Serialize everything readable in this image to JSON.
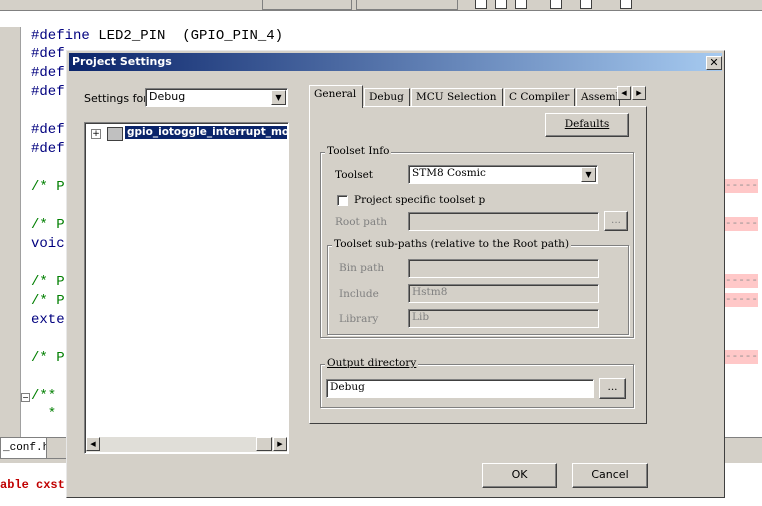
{
  "editor": {
    "lines": [
      {
        "kw": "#define",
        "rest": " LED2_PIN  (GPIO_PIN_4)"
      },
      {
        "kw": "#def",
        "rest": ""
      },
      {
        "kw": "#def",
        "rest": ""
      },
      {
        "kw": "#def",
        "rest": ""
      },
      {
        "kw": "#def",
        "rest": ""
      },
      {
        "kw": "#def",
        "rest": ""
      },
      {
        "cm": "/* P"
      },
      {
        "cm": "/* P"
      },
      {
        "kw": "voic",
        "rest": ""
      },
      {
        "cm": "/* P"
      },
      {
        "cm": "/* P"
      },
      {
        "kw": "exte",
        "rest": ""
      },
      {
        "cm": "/* P"
      },
      {
        "cm": "/**"
      },
      {
        "cm": "  *"
      }
    ],
    "dashes": "-----",
    "file_tab": "_conf.h",
    "output_text": "able cxst"
  },
  "dialog": {
    "title": "Project Settings",
    "close_glyph": "✕",
    "settings_for_label": "Settings for:",
    "settings_for_value": "Debug",
    "tree_item": "gpio_iotoggle_interrupt_mo",
    "tabs": [
      "General",
      "Debug",
      "MCU Selection",
      "C Compiler",
      "Assemb"
    ],
    "defaults_button": "Defaults",
    "toolset_info": {
      "group_title": "Toolset Info",
      "toolset_label": "Toolset",
      "toolset_value": "STM8 Cosmic",
      "project_specific_label": "Project specific toolset p",
      "root_path_label": "Root path",
      "root_path_value": "",
      "browse_label": "...",
      "subpaths_title": "Toolset sub-paths (relative to the Root path)",
      "bin_path_label": "Bin path",
      "bin_path_value": "",
      "include_label": "Include",
      "include_value": "Hstm8",
      "library_label": "Library",
      "library_value": "Lib"
    },
    "output_directory": {
      "group_title": "Output directory",
      "value": "Debug",
      "browse_label": "..."
    },
    "ok_button": "OK",
    "cancel_button": "Cancel"
  },
  "icons": {
    "close": "close-icon",
    "dropdown": "chevron-down-icon",
    "tab_scroll_left": "triangle-left-icon",
    "tab_scroll_right": "triangle-right-icon",
    "tree_expand": "plus-icon",
    "project": "project-icon"
  },
  "colors": {
    "titlebar_start": "#0a246a",
    "titlebar_end": "#a6caf0",
    "dialog_face": "#d4d0c8",
    "selection": "#0a246a",
    "keyword": "#00007f",
    "comment": "#007f00",
    "error": "#c00000"
  }
}
